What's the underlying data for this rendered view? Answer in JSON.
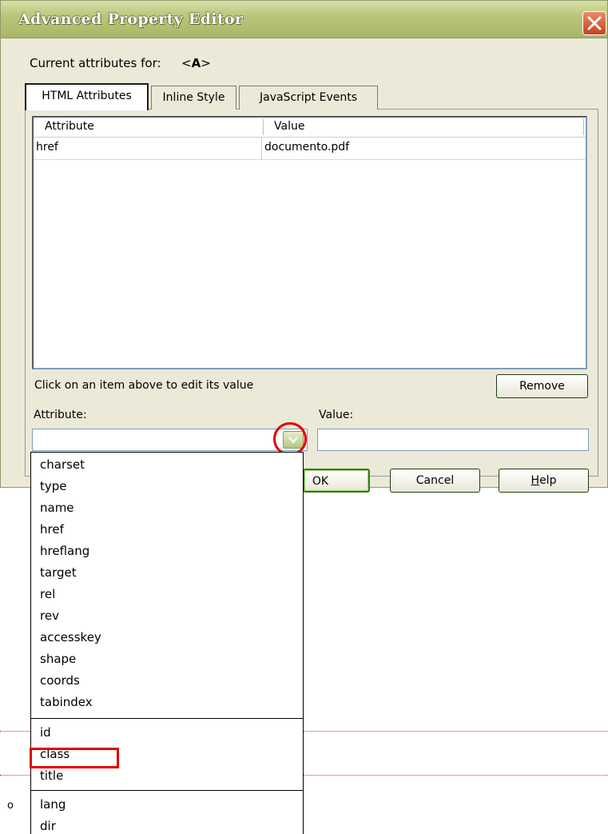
{
  "window": {
    "title": "Advanced Property Editor",
    "current_label": "Current attributes for:",
    "current_tag_open": "<",
    "current_tag_name": "A",
    "current_tag_close": ">"
  },
  "tabs": [
    {
      "label": "HTML Attributes",
      "active": true
    },
    {
      "label": "Inline Style",
      "active": false
    },
    {
      "label": "JavaScript Events",
      "active": false
    }
  ],
  "table": {
    "columns": [
      "Attribute",
      "Value"
    ],
    "rows": [
      {
        "attribute": "href",
        "value": "documento.pdf"
      }
    ]
  },
  "hint": "Click on an item above to edit its value",
  "buttons": {
    "remove": "Remove",
    "ok": "OK",
    "cancel": "Cancel",
    "help_first": "H",
    "help_rest": "elp"
  },
  "fields": {
    "attribute_label": "Attribute:",
    "attribute_value": "",
    "value_label": "Value:",
    "value_value": ""
  },
  "dropdown": {
    "group1": [
      "charset",
      "type",
      "name",
      "href",
      "hreflang",
      "target",
      "rel",
      "rev",
      "accesskey",
      "shape",
      "coords",
      "tabindex"
    ],
    "group2": [
      "id",
      "class",
      "title"
    ],
    "group3": [
      "lang",
      "dir"
    ],
    "highlighted": "class"
  },
  "page_marks": {
    "bullet": "o"
  },
  "colors": {
    "dialog_bg": "#ECE9D8",
    "titlebar": "#A9B566",
    "annotation_red": "#E00000"
  }
}
